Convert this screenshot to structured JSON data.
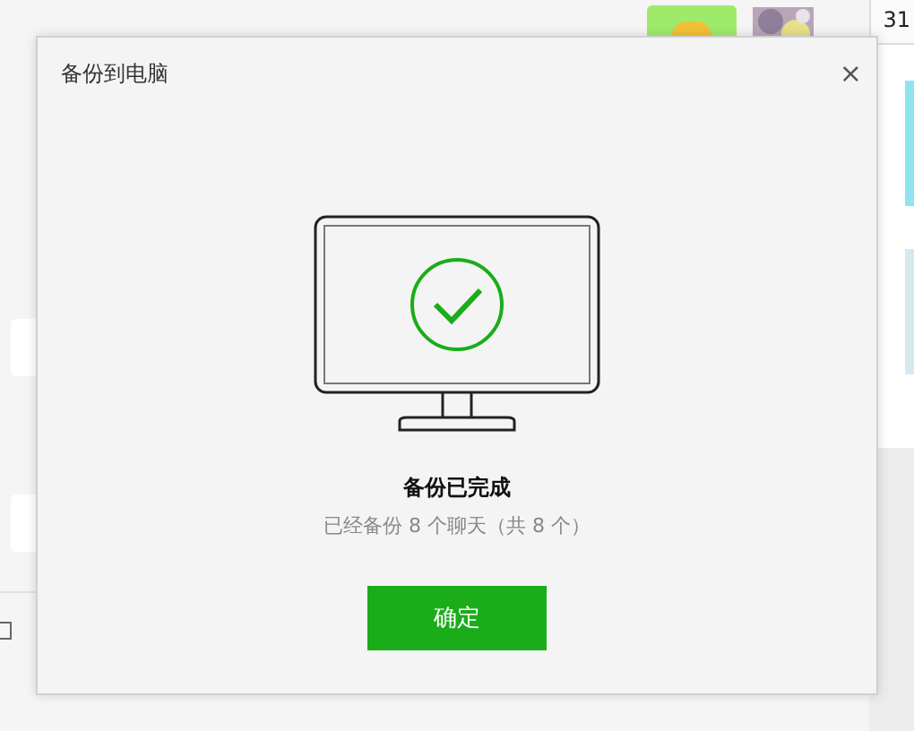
{
  "background": {
    "side_panel": {
      "number": "31"
    }
  },
  "dialog": {
    "title": "备份到电脑",
    "close": "×",
    "status": "备份已完成",
    "detail": "已经备份 8 个聊天（共 8 个）",
    "button": "确定"
  }
}
